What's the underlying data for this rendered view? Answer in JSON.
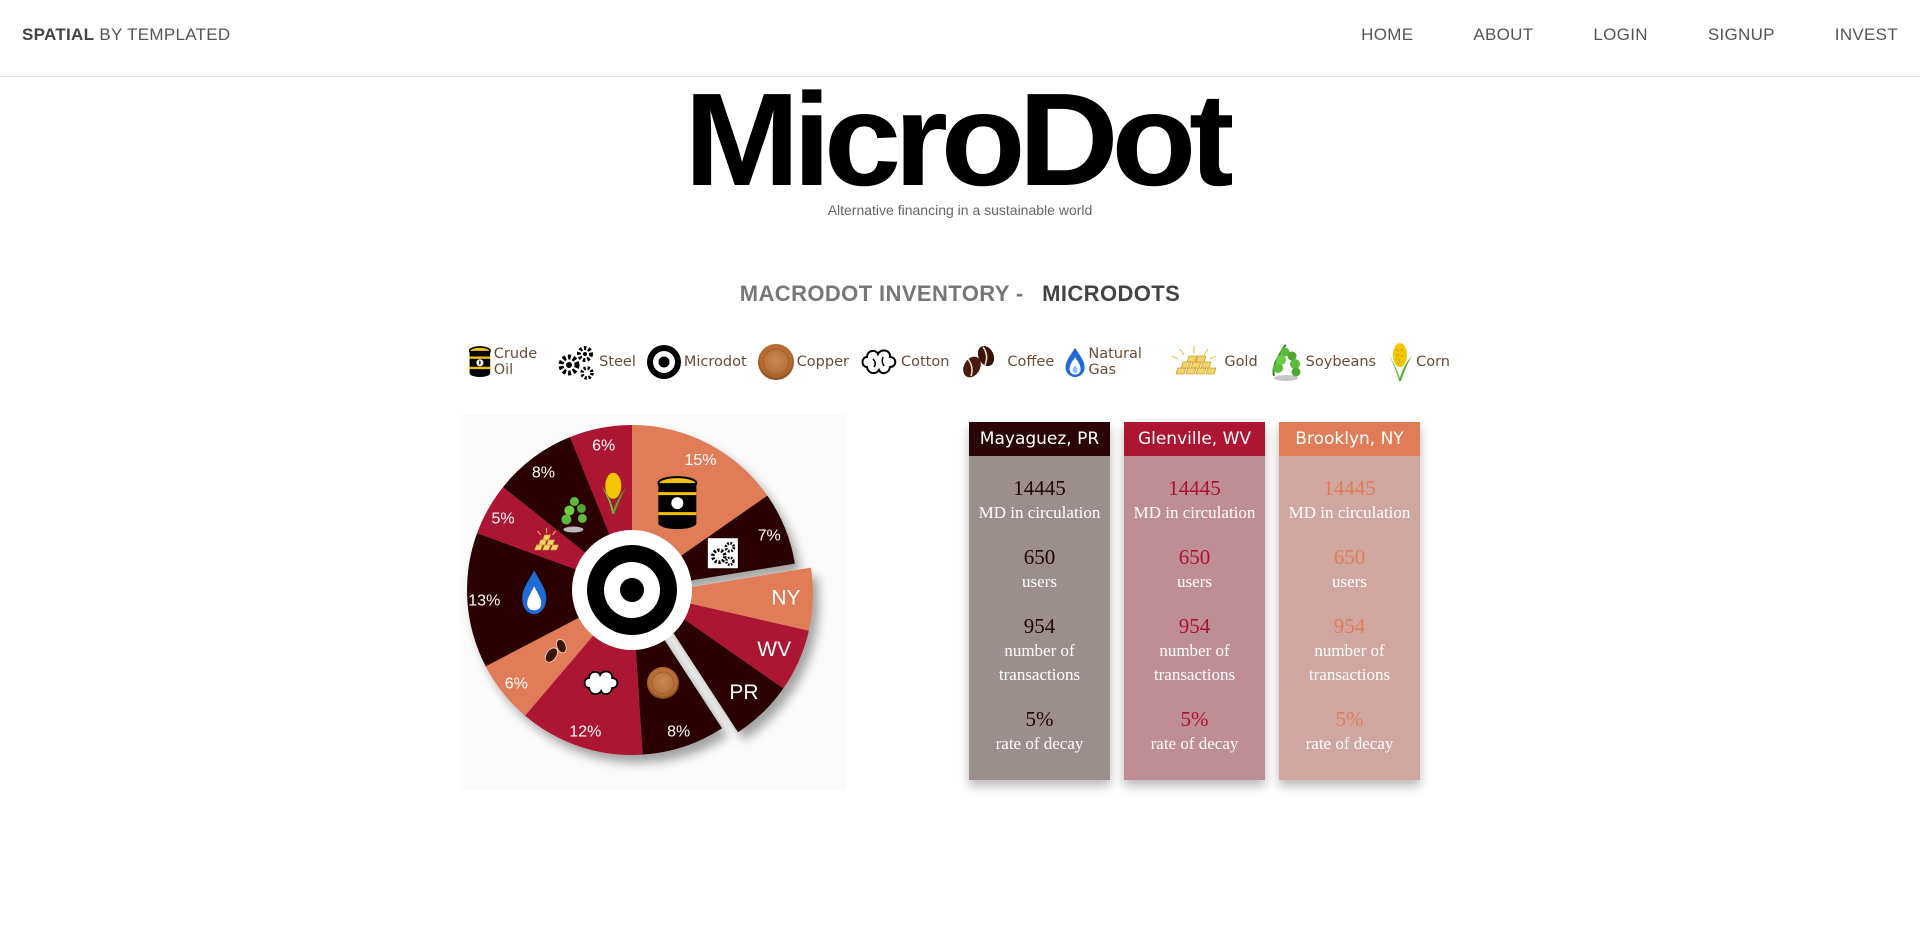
{
  "header": {
    "brand_bold": "SPATIAL",
    "brand_rest": "BY TEMPLATED",
    "nav": [
      "HOME",
      "ABOUT",
      "LOGIN",
      "SIGNUP",
      "INVEST"
    ]
  },
  "hero": {
    "logo_text": "MicroDot",
    "tagline": "Alternative financing in a sustainable world"
  },
  "section": {
    "title_part1": "MACRODOT INVENTORY -",
    "title_part2": "MICRODOTS"
  },
  "legend": [
    {
      "label": "Crude Oil",
      "icon": "oil-barrel-icon"
    },
    {
      "label": "Steel",
      "icon": "gears-icon"
    },
    {
      "label": "Microdot",
      "icon": "microdot-icon"
    },
    {
      "label": "Copper",
      "icon": "copper-coin-icon"
    },
    {
      "label": "Cotton",
      "icon": "cotton-icon"
    },
    {
      "label": "Coffee",
      "icon": "coffee-beans-icon"
    },
    {
      "label": "Natural Gas",
      "icon": "flame-icon"
    },
    {
      "label": "Gold",
      "icon": "gold-bars-icon"
    },
    {
      "label": "Soybeans",
      "icon": "soybean-icon"
    },
    {
      "label": "Corn",
      "icon": "corn-icon"
    }
  ],
  "chart_data": {
    "type": "pie",
    "slices": [
      {
        "label": "15%",
        "value": 15,
        "commodity": "Crude Oil",
        "color": "#e07d58"
      },
      {
        "label": "7%",
        "value": 7,
        "commodity": "Steel",
        "color": "#2b0505"
      },
      {
        "label": "NY",
        "value": 6,
        "color": "#e07d58"
      },
      {
        "label": "WV",
        "value": 6,
        "color": "#ad1530"
      },
      {
        "label": "PR",
        "value": 6,
        "color": "#2b0505"
      },
      {
        "label": "8%",
        "value": 8,
        "commodity": "Copper",
        "color": "#2b0505"
      },
      {
        "label": "12%",
        "value": 12,
        "commodity": "Cotton",
        "color": "#ad1530"
      },
      {
        "label": "6%",
        "value": 6,
        "commodity": "Coffee",
        "color": "#e07d58"
      },
      {
        "label": "13%",
        "value": 13,
        "commodity": "Natural Gas",
        "color": "#2b0505"
      },
      {
        "label": "5%",
        "value": 5,
        "commodity": "Gold",
        "color": "#ad1530"
      },
      {
        "label": "8%",
        "value": 8,
        "commodity": "Soybeans",
        "color": "#2b0505"
      },
      {
        "label": "6%",
        "value": 6,
        "commodity": "Corn",
        "color": "#ad1530"
      }
    ]
  },
  "cards": [
    {
      "title": "Mayaguez, PR",
      "md": "14445",
      "md_label": "MD in circulation",
      "users": "650",
      "users_label": "users",
      "tx": "954",
      "tx_label1": "number of",
      "tx_label2": "transactions",
      "decay": "5%",
      "decay_label": "rate of decay"
    },
    {
      "title": "Glenville, WV",
      "md": "14445",
      "md_label": "MD in circulation",
      "users": "650",
      "users_label": "users",
      "tx": "954",
      "tx_label1": "number of",
      "tx_label2": "transactions",
      "decay": "5%",
      "decay_label": "rate of decay"
    },
    {
      "title": "Brooklyn, NY",
      "md": "14445",
      "md_label": "MD in circulation",
      "users": "650",
      "users_label": "users",
      "tx": "954",
      "tx_label1": "number of",
      "tx_label2": "transactions",
      "decay": "5%",
      "decay_label": "rate of decay"
    }
  ]
}
